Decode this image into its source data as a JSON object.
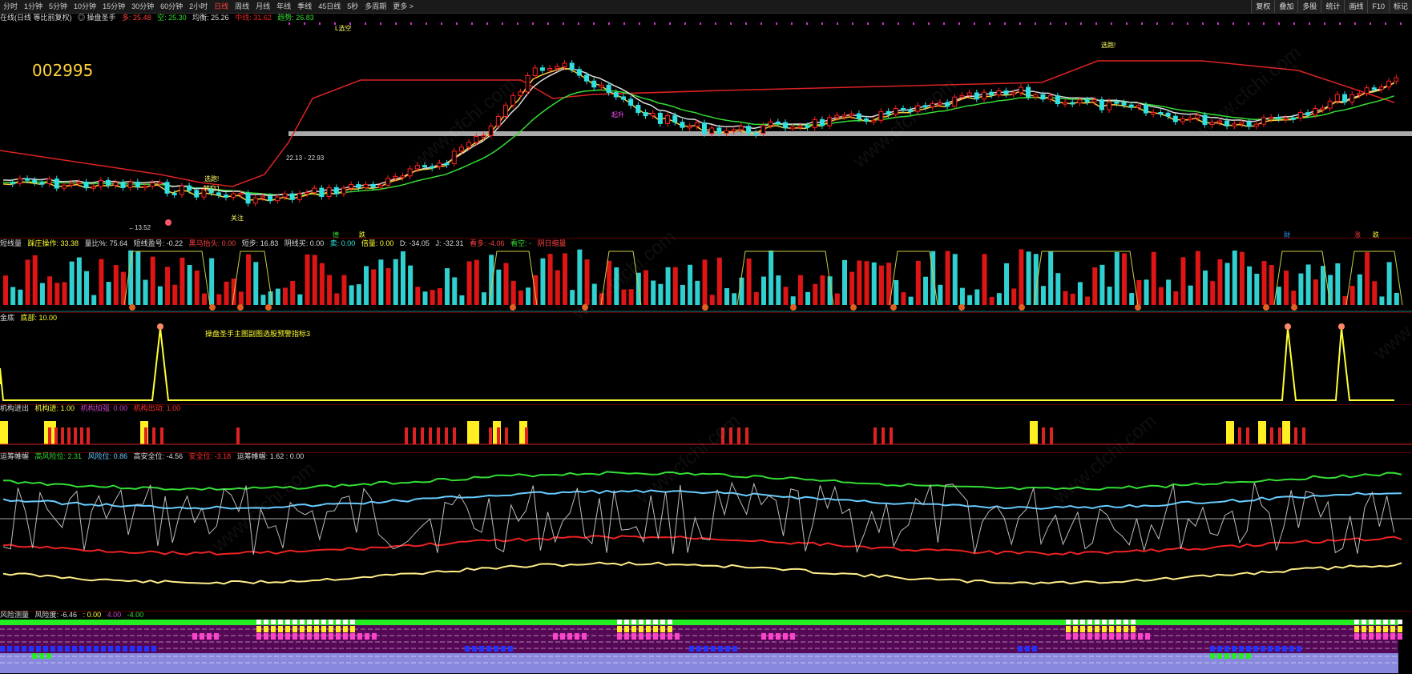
{
  "toolbar": {
    "periods": [
      "分时",
      "1分钟",
      "5分钟",
      "10分钟",
      "15分钟",
      "30分钟",
      "60分钟",
      "2小时",
      "日线",
      "周线",
      "月线",
      "年线",
      "季线",
      "45日线",
      "5秒",
      "多周期",
      "更多 >"
    ],
    "active_period": "日线",
    "right_buttons": [
      "复权",
      "叠加",
      "多股",
      "统计",
      "画线",
      "F10",
      "标记"
    ]
  },
  "main_info": {
    "label": "在线(日线 等比前复权)",
    "indicator": "◎ 操盘圣手",
    "duo_label": "多: 25.48",
    "kong_label": "空: 25.30",
    "junheng_label": "均衡: 25.26",
    "zhongxian_label": "中线: 31.62",
    "qushi_label": "趋势: 26.83"
  },
  "stock_code": "002995",
  "main_annotations": {
    "price_low": "←13.52",
    "range_label": "22.13 - 22.93",
    "liangkong_top": "L选空",
    "xuanjin": "选跑!",
    "zhuankong": "转空1",
    "guanzhu": "关注",
    "xiangsheng": "起升"
  },
  "volume_info": {
    "label": "短线量",
    "a": "踩庄操作: 33.38",
    "b": "量比%: 75.64",
    "c": "短线盈号: -0.22",
    "d": "黑马抬头: 0.00",
    "e": "短步: 16.83",
    "f": "阴线买: 0.00",
    "g": "卖: 0.00",
    "h": "倍量: 0.00",
    "i": "D: -34.05",
    "j": "J: -32.31",
    "k": "看多: -4.06",
    "l": "看空: -",
    "m": "阴日缩量"
  },
  "top_tags": {
    "de": "德",
    "die": "跌",
    "cai": "财",
    "zhang": "涨",
    "zhang2": "跌"
  },
  "panel3_info": {
    "label": "金底",
    "value": "底部: 10.00",
    "center_text": "操盘圣手主图副图选股预警指标3"
  },
  "panel4_info": {
    "label": "机构进出",
    "a": "机构进: 1.00",
    "b": "机构加强: 0.00",
    "c": "机构出动: 1.00"
  },
  "panel5_info": {
    "label": "运筹帷幄",
    "a": "高风险位: 2.31",
    "b": "风险位: 0.86",
    "c": "高安全位: -4.56",
    "d": "安全位: -3.18",
    "e": "运筹帷幄: 1.62 : 0.00"
  },
  "panel6_info": {
    "label": "风险测量",
    "a": "风险度: -6.46",
    "b": ": 0.00",
    "c": "4.00",
    "d": "-4.00"
  },
  "watermark": "www.cfchi.com",
  "colors": {
    "up": "#ff2020",
    "down": "#30e0e0",
    "yellow": "#ffff33",
    "green": "#33dd33",
    "red": "#ee2222",
    "white": "#e0e0e0",
    "bg": "#000000"
  }
}
